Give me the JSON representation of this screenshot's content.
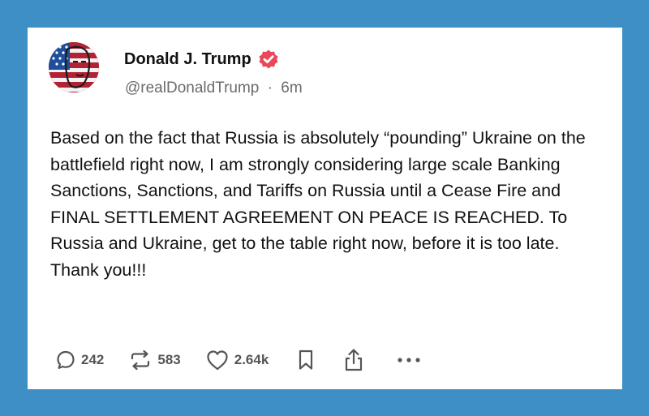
{
  "post": {
    "author_name": "Donald J. Trump",
    "handle": "@realDonaldTrump",
    "separator": "·",
    "time_ago": "6m",
    "verified_icon": "verified-badge-icon",
    "text": "Based on the fact that Russia is absolutely “pounding” Ukraine on the battlefield right now, I am strongly considering large scale Banking Sanctions, Sanctions, and Tariffs on Russia until a Cease Fire and FINAL SETTLEMENT AGREEMENT ON PEACE IS REACHED. To Russia and Ukraine, get to the table right now, before it is too late. Thank you!!!"
  },
  "actions": {
    "replies": "242",
    "reposts": "583",
    "likes": "2.64k"
  },
  "colors": {
    "background": "#3e8fc6",
    "card": "#ffffff",
    "verified_badge": "#e8485a",
    "muted_text": "#6b6b6b"
  }
}
